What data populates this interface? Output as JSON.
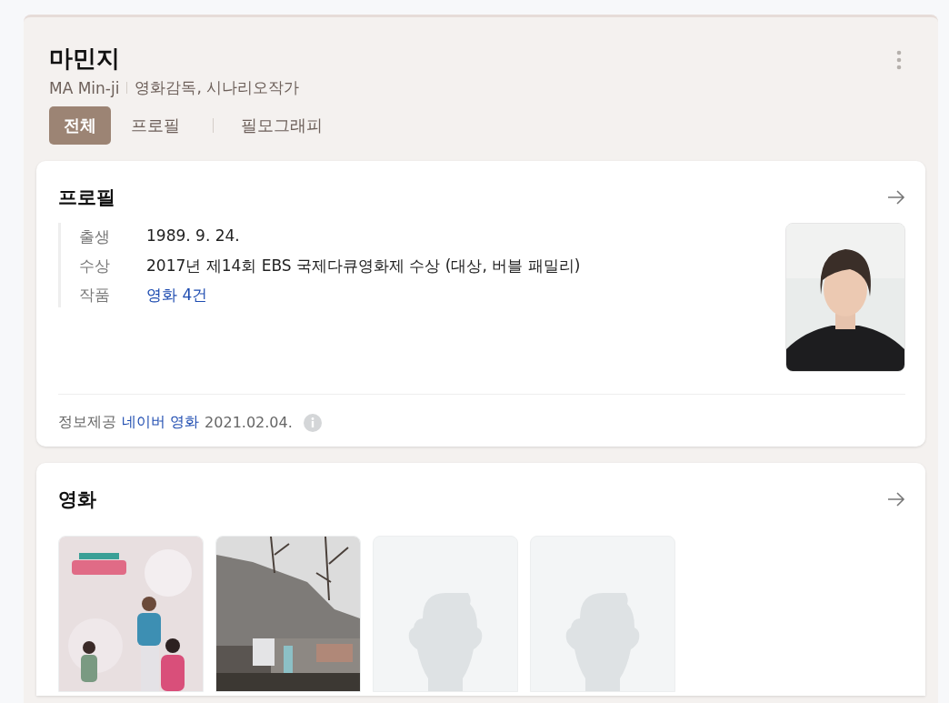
{
  "header": {
    "name": "마민지",
    "name_en": "MA Min-ji",
    "roles": "영화감독, 시나리오작가"
  },
  "tabs": [
    {
      "label": "전체",
      "selected": true
    },
    {
      "label": "프로필",
      "selected": false
    },
    {
      "label": "필모그래피",
      "selected": false
    }
  ],
  "profile": {
    "title": "프로필",
    "rows": [
      {
        "label": "출생",
        "value": "1989. 9. 24.",
        "kind": "text"
      },
      {
        "label": "수상",
        "value": "2017년 제14회 EBS 국제다큐영화제 수상 (대상, 버블 패밀리)",
        "kind": "text"
      },
      {
        "label": "작품",
        "value": "영화 4건",
        "kind": "link"
      }
    ],
    "photo": {
      "kind": "picture"
    },
    "source": {
      "label": "정보제공",
      "provider": "네이버 영화",
      "date": "2021.02.04."
    }
  },
  "movies": {
    "title": "영화",
    "posters": [
      {
        "kind": "picture"
      },
      {
        "kind": "picture"
      },
      {
        "kind": "placeholder"
      },
      {
        "kind": "placeholder"
      }
    ]
  }
}
